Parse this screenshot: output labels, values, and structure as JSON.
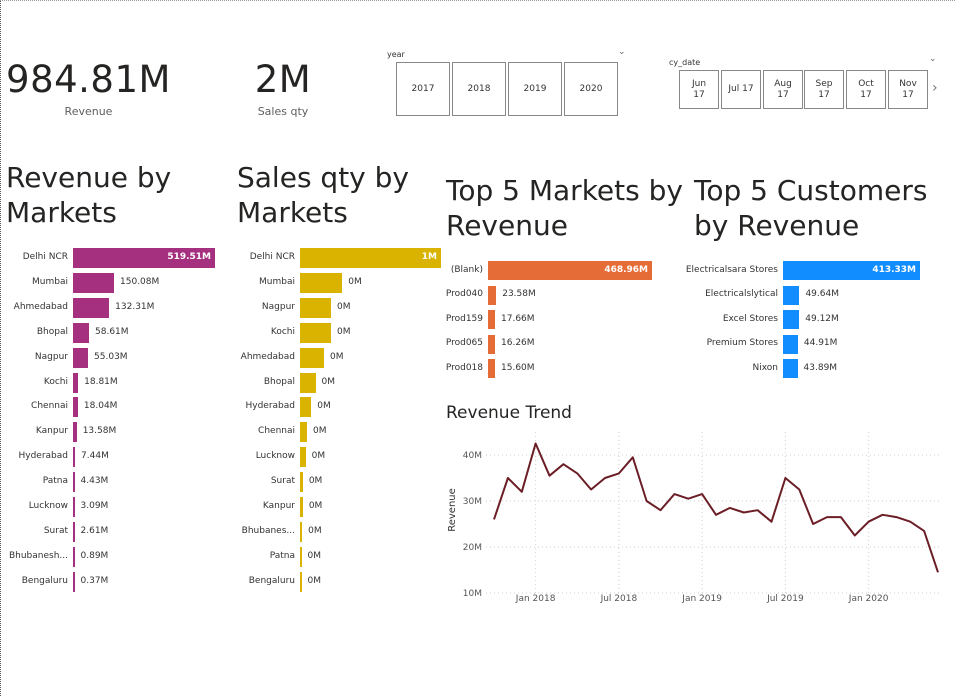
{
  "kpis": {
    "revenue": {
      "value": "984.81M",
      "label": "Revenue"
    },
    "sales_qty": {
      "value": "2M",
      "label": "Sales qty"
    }
  },
  "year_slicer": {
    "title": "year",
    "options": [
      "2017",
      "2018",
      "2019",
      "2020"
    ],
    "chevron_icon": "chevron-down-icon"
  },
  "date_slicer": {
    "title": "cy_date",
    "options": [
      {
        "month": "Jun",
        "year": "17"
      },
      {
        "month": "Jul 17",
        "year": ""
      },
      {
        "month": "Aug",
        "year": "17"
      },
      {
        "month": "Sep",
        "year": "17"
      },
      {
        "month": "Oct",
        "year": "17"
      },
      {
        "month": "Nov",
        "year": "17"
      }
    ],
    "chevron_icon": "chevron-down-icon",
    "next_icon": "chevron-right-icon"
  },
  "revenue_by_markets": {
    "title": "Revenue by Markets",
    "color": "#A4307F",
    "chart_data": {
      "type": "bar",
      "categories": [
        "Delhi NCR",
        "Mumbai",
        "Ahmedabad",
        "Bhopal",
        "Nagpur",
        "Kochi",
        "Chennai",
        "Kanpur",
        "Hyderabad",
        "Patna",
        "Lucknow",
        "Surat",
        "Bhubanesh...",
        "Bengaluru"
      ],
      "values": [
        519.51,
        150.08,
        132.31,
        58.61,
        55.03,
        18.81,
        18.04,
        13.58,
        7.44,
        4.43,
        3.09,
        2.61,
        0.89,
        0.37
      ],
      "labels": [
        "519.51M",
        "150.08M",
        "132.31M",
        "58.61M",
        "55.03M",
        "18.81M",
        "18.04M",
        "13.58M",
        "7.44M",
        "4.43M",
        "3.09M",
        "2.61M",
        "0.89M",
        "0.37M"
      ]
    }
  },
  "sales_qty_by_markets": {
    "title": "Sales qty by Markets",
    "color": "#D9B300",
    "chart_data": {
      "type": "bar",
      "categories": [
        "Delhi NCR",
        "Mumbai",
        "Nagpur",
        "Kochi",
        "Ahmedabad",
        "Bhopal",
        "Hyderabad",
        "Chennai",
        "Lucknow",
        "Surat",
        "Kanpur",
        "Bhubanes...",
        "Patna",
        "Bengaluru"
      ],
      "values": [
        1.0,
        0.3,
        0.22,
        0.22,
        0.17,
        0.11,
        0.08,
        0.05,
        0.04,
        0.02,
        0.02,
        0.015,
        0.01,
        0.005
      ],
      "labels": [
        "1M",
        "0M",
        "0M",
        "0M",
        "0M",
        "0M",
        "0M",
        "0M",
        "0M",
        "0M",
        "0M",
        "0M",
        "0M",
        "0M"
      ]
    }
  },
  "top5_markets": {
    "title": "Top 5 Markets by Revenue",
    "color": "#E66C37",
    "chart_data": {
      "type": "bar",
      "categories": [
        "(Blank)",
        "Prod040",
        "Prod159",
        "Prod065",
        "Prod018"
      ],
      "values": [
        468.96,
        23.58,
        17.66,
        16.26,
        15.6
      ],
      "labels": [
        "468.96M",
        "23.58M",
        "17.66M",
        "16.26M",
        "15.60M"
      ]
    }
  },
  "top5_customers": {
    "title": "Top 5 Customers by Revenue",
    "color": "#118DFF",
    "chart_data": {
      "type": "bar",
      "categories": [
        "Electricalsara Stores",
        "Electricalslytical",
        "Excel Stores",
        "Premium Stores",
        "Nixon"
      ],
      "values": [
        413.33,
        49.64,
        49.12,
        44.91,
        43.89
      ],
      "labels": [
        "413.33M",
        "49.64M",
        "49.12M",
        "44.91M",
        "43.89M"
      ]
    }
  },
  "revenue_trend": {
    "title": "Revenue Trend",
    "color": "#6B1E26",
    "chart_data": {
      "type": "line",
      "ylabel": "Revenue",
      "xlabel": "",
      "ylim": [
        10,
        45
      ],
      "y_ticks": [
        "10M",
        "20M",
        "30M",
        "40M"
      ],
      "y_tick_values": [
        10,
        20,
        30,
        40
      ],
      "x_ticks": [
        "Jan 2018",
        "Jul 2018",
        "Jan 2019",
        "Jul 2019",
        "Jan 2020"
      ],
      "x_tick_values": [
        "2018-01",
        "2018-07",
        "2019-01",
        "2019-07",
        "2020-01"
      ],
      "x": [
        "2017-10",
        "2017-11",
        "2017-12",
        "2018-01",
        "2018-02",
        "2018-03",
        "2018-04",
        "2018-05",
        "2018-06",
        "2018-07",
        "2018-08",
        "2018-09",
        "2018-10",
        "2018-11",
        "2018-12",
        "2019-01",
        "2019-02",
        "2019-03",
        "2019-04",
        "2019-05",
        "2019-06",
        "2019-07",
        "2019-08",
        "2019-09",
        "2019-10",
        "2019-11",
        "2019-12",
        "2020-01",
        "2020-02",
        "2020-03",
        "2020-04",
        "2020-05",
        "2020-06"
      ],
      "values": [
        26.0,
        35.0,
        32.0,
        42.5,
        35.5,
        38.0,
        36.0,
        32.5,
        35.0,
        36.0,
        39.5,
        30.0,
        28.0,
        31.5,
        30.5,
        31.5,
        27.0,
        28.5,
        27.5,
        28.0,
        25.5,
        35.0,
        32.5,
        25.0,
        26.5,
        26.5,
        22.5,
        25.5,
        27.0,
        26.5,
        25.5,
        23.5,
        14.5
      ],
      "grid": true
    }
  }
}
